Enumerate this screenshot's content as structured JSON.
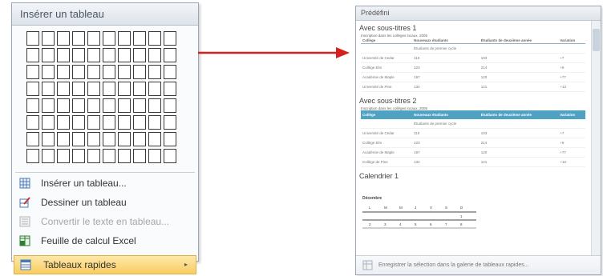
{
  "menu": {
    "title": "Insérer un tableau",
    "grid": {
      "columns": 10,
      "rows": 8
    },
    "items": [
      {
        "label": "Insérer un tableau...",
        "icon": "table-icon",
        "disabled": false
      },
      {
        "label": "Dessiner un tableau",
        "icon": "draw-table-icon",
        "disabled": false
      },
      {
        "label": "Convertir le texte en tableau...",
        "icon": "convert-text-icon",
        "disabled": true
      },
      {
        "label": "Feuille de calcul Excel",
        "icon": "excel-sheet-icon",
        "disabled": false
      },
      {
        "label": "Tableaux rapides",
        "icon": "quick-tables-icon",
        "highlighted": true,
        "submenu_arrow": "▸"
      }
    ]
  },
  "arrow": {
    "color": "#d42020",
    "icon": "right-arrow-icon"
  },
  "gallery": {
    "header": "Prédéfini",
    "sections": [
      {
        "title": "Avec sous-titres 1",
        "caption": "Inscription dans les collèges locaux, 2005",
        "columns": [
          "Collège",
          "Nouveaux étudiants",
          "Étudiants de deuxième année",
          "Variation"
        ],
        "rows": [
          [
            "",
            "Étudiants de premier cycle",
            "",
            ""
          ],
          [
            "Université de Cedar",
            "110",
            "103",
            "+7"
          ],
          [
            "Collège Elm",
            "223",
            "214",
            "+9"
          ],
          [
            "Académie de Maple",
            "197",
            "120",
            "+77"
          ],
          [
            "Université de Pine",
            "134",
            "121",
            "+13"
          ]
        ]
      },
      {
        "title": "Avec sous-titres 2",
        "caption": "Inscription dans les collèges locaux, 2005",
        "columns": [
          "Collège",
          "Nouveaux étudiants",
          "Étudiants de deuxième année",
          "Variation"
        ],
        "rows": [
          [
            "",
            "Étudiants de premier cycle",
            "",
            ""
          ],
          [
            "Université de Cedar",
            "110",
            "103",
            "+7"
          ],
          [
            "Collège Elm",
            "223",
            "214",
            "+9"
          ],
          [
            "Académie de Maple",
            "197",
            "120",
            "+77"
          ],
          [
            "Collège de Pine",
            "134",
            "121",
            "+13"
          ]
        ]
      }
    ],
    "calendar": {
      "title": "Calendrier 1",
      "month": "Décembre",
      "weekdays": [
        "L",
        "M",
        "M",
        "J",
        "V",
        "S",
        "D"
      ],
      "first_row": [
        "",
        "",
        "",
        "",
        "",
        "",
        "1"
      ],
      "second_row": [
        "2",
        "3",
        "4",
        "5",
        "6",
        "7",
        "8"
      ]
    },
    "footer": "Enregistrer la sélection dans la galerie de tableaux rapides..."
  }
}
